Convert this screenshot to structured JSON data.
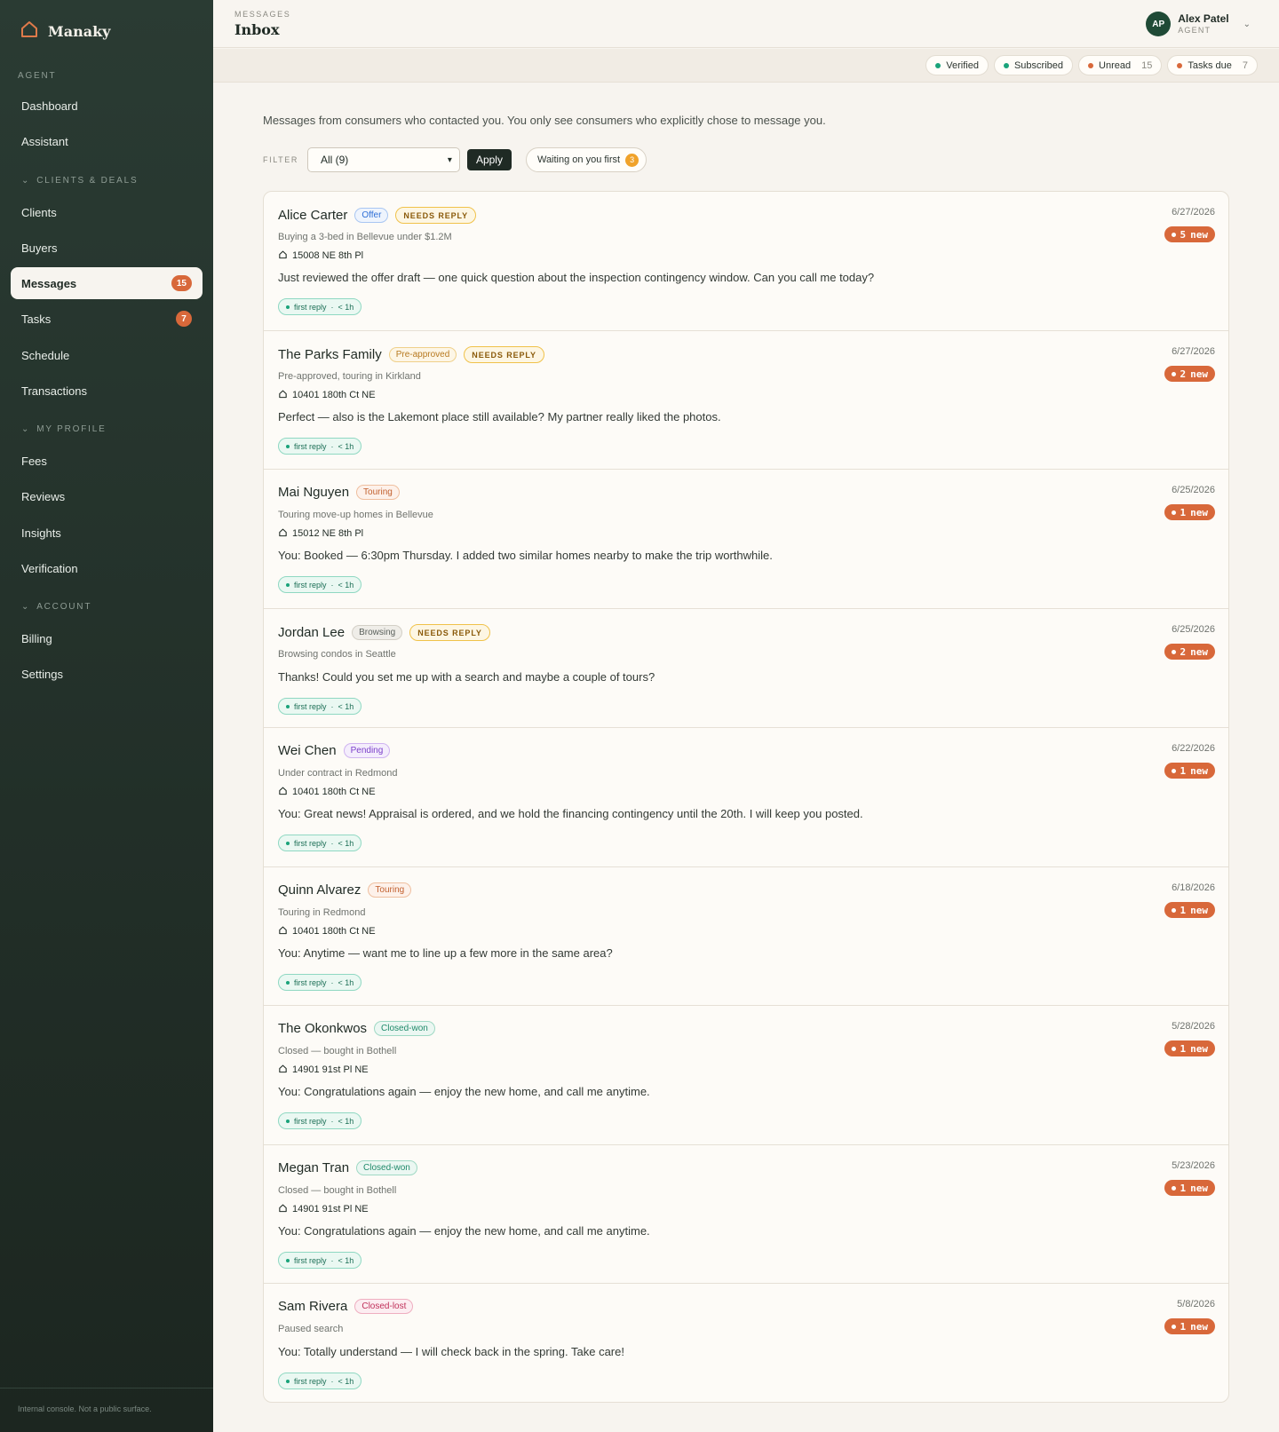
{
  "app": {
    "name": "Manaky",
    "footer": "Internal console. Not a public surface."
  },
  "sidebar": {
    "sections": [
      {
        "label": "AGENT"
      },
      {
        "label": "CLIENTS & DEALS"
      },
      {
        "label": "MY PROFILE"
      },
      {
        "label": "ACCOUNT"
      }
    ],
    "items": [
      {
        "label": "Dashboard"
      },
      {
        "label": "Assistant"
      },
      {
        "label": "Clients"
      },
      {
        "label": "Buyers"
      },
      {
        "label": "Messages",
        "badge": "15"
      },
      {
        "label": "Tasks",
        "badge": "7"
      },
      {
        "label": "Schedule"
      },
      {
        "label": "Transactions"
      },
      {
        "label": "Fees"
      },
      {
        "label": "Reviews"
      },
      {
        "label": "Insights"
      },
      {
        "label": "Verification"
      },
      {
        "label": "Billing"
      },
      {
        "label": "Settings"
      }
    ]
  },
  "header": {
    "eyebrow": "MESSAGES",
    "title": "Inbox",
    "user": {
      "initials": "AP",
      "name": "Alex Patel",
      "role": "AGENT"
    }
  },
  "status": {
    "pills": [
      {
        "label": "Verified",
        "color": "#1aa37a"
      },
      {
        "label": "Subscribed",
        "color": "#1aa37a"
      },
      {
        "label": "Unread",
        "count": "15",
        "color": "#d8683a"
      },
      {
        "label": "Tasks due",
        "count": "7",
        "color": "#d8683a"
      }
    ]
  },
  "main": {
    "intro": "Messages from consumers who contacted you. You only see consumers who explicitly chose to message you.",
    "filter": {
      "label": "FILTER",
      "value": "All (9)",
      "apply": "Apply",
      "waiting": "Waiting on you first",
      "waiting_count": "3"
    },
    "needs_reply_label": "NEEDS REPLY",
    "reply_label": "first reply",
    "reply_time": "< 1h",
    "new_suffix": "new",
    "threads": [
      {
        "name": "Alice Carter",
        "tag": "Offer",
        "needs": true,
        "sub": "Buying a 3-bed in Bellevue under $1.2M",
        "address": "15008 NE 8th Pl",
        "message": "Just reviewed the offer draft — one quick question about the inspection contingency window. Can you call me today?",
        "date": "6/27/2026",
        "new": "5"
      },
      {
        "name": "The Parks Family",
        "tag": "Pre-approved",
        "needs": true,
        "sub": "Pre-approved, touring in Kirkland",
        "address": "10401 180th Ct NE",
        "message": "Perfect — also is the Lakemont place still available? My partner really liked the photos.",
        "date": "6/27/2026",
        "new": "2"
      },
      {
        "name": "Mai Nguyen",
        "tag": "Touring",
        "needs": false,
        "sub": "Touring move-up homes in Bellevue",
        "address": "15012 NE 8th Pl",
        "message": "You: Booked — 6:30pm Thursday. I added two similar homes nearby to make the trip worthwhile.",
        "date": "6/25/2026",
        "new": "1"
      },
      {
        "name": "Jordan Lee",
        "tag": "Browsing",
        "needs": true,
        "sub": "Browsing condos in Seattle",
        "address": "",
        "message": "Thanks! Could you set me up with a search and maybe a couple of tours?",
        "date": "6/25/2026",
        "new": "2"
      },
      {
        "name": "Wei Chen",
        "tag": "Pending",
        "needs": false,
        "sub": "Under contract in Redmond",
        "address": "10401 180th Ct NE",
        "message": "You: Great news! Appraisal is ordered, and we hold the financing contingency until the 20th. I will keep you posted.",
        "date": "6/22/2026",
        "new": "1"
      },
      {
        "name": "Quinn Alvarez",
        "tag": "Touring",
        "needs": false,
        "sub": "Touring in Redmond",
        "address": "10401 180th Ct NE",
        "message": "You: Anytime — want me to line up a few more in the same area?",
        "date": "6/18/2026",
        "new": "1"
      },
      {
        "name": "The Okonkwos",
        "tag": "Closed-won",
        "needs": false,
        "sub": "Closed — bought in Bothell",
        "address": "14901 91st Pl NE",
        "message": "You: Congratulations again — enjoy the new home, and call me anytime.",
        "date": "5/28/2026",
        "new": "1"
      },
      {
        "name": "Megan Tran",
        "tag": "Closed-won",
        "needs": false,
        "sub": "Closed — bought in Bothell",
        "address": "14901 91st Pl NE",
        "message": "You: Congratulations again — enjoy the new home, and call me anytime.",
        "date": "5/23/2026",
        "new": "1"
      },
      {
        "name": "Sam Rivera",
        "tag": "Closed-lost",
        "needs": false,
        "sub": "Paused search",
        "address": "",
        "message": "You: Totally understand — I will check back in the spring. Take care!",
        "date": "5/8/2026",
        "new": "1"
      }
    ]
  },
  "colors": {
    "accent": "#d8683a",
    "sidebar": "#24332b",
    "tag_offer": "#2f6fd6",
    "tag_preapproved": "#b7791f",
    "tag_touring": "#c2602e",
    "tag_browsing": "#5b615c",
    "tag_pending": "#7b3fc9",
    "tag_won": "#1f8a6a",
    "tag_lost": "#c0305a"
  }
}
